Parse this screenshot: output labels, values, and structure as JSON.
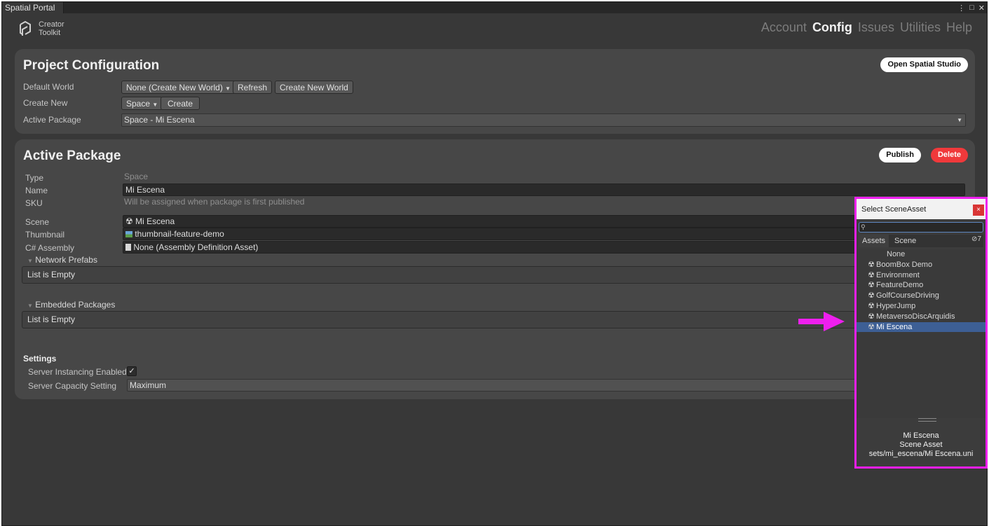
{
  "window": {
    "tab_title": "Spatial Portal",
    "controls": [
      "⋮",
      "□",
      "✕"
    ]
  },
  "logo": {
    "line1": "Creator",
    "line2": "Toolkit",
    "icon": "spatial-logo-icon"
  },
  "nav": {
    "items": [
      "Account",
      "Config",
      "Issues",
      "Utilities",
      "Help"
    ],
    "active": "Config"
  },
  "project_config": {
    "title": "Project Configuration",
    "open_studio_button": "Open Spatial Studio",
    "default_world_label": "Default World",
    "default_world_value": "None (Create New World)",
    "refresh_button": "Refresh",
    "create_world_button": "Create New World",
    "create_new_label": "Create New",
    "create_new_value": "Space",
    "create_button": "Create",
    "active_package_label": "Active Package",
    "active_package_value": "Space - Mi Escena"
  },
  "active_package": {
    "title": "Active Package",
    "publish_button": "Publish",
    "delete_button": "Delete",
    "type_label": "Type",
    "type_value": "Space",
    "name_label": "Name",
    "name_value": "Mi Escena",
    "sku_label": "SKU",
    "sku_value": "Will be assigned when package is first published",
    "scene_label": "Scene",
    "scene_value": "Mi Escena",
    "thumbnail_label": "Thumbnail",
    "thumbnail_value": "thumbnail-feature-demo",
    "assembly_label": "C# Assembly",
    "assembly_value": "None (Assembly Definition Asset)",
    "network_prefabs_label": "Network Prefabs",
    "network_prefabs_list": "List is Empty",
    "embedded_packages_label": "Embedded Packages",
    "embedded_packages_list": "List is Empty",
    "settings_heading": "Settings",
    "server_instancing_label": "Server Instancing Enabled",
    "server_instancing_checked": true,
    "server_capacity_label": "Server Capacity Setting",
    "server_capacity_value": "Maximum"
  },
  "picker": {
    "title": "Select SceneAsset",
    "close_glyph": "×",
    "search_value": "",
    "tabs": [
      "Assets",
      "Scene"
    ],
    "active_tab": "Assets",
    "hidden_count": "7",
    "items": [
      "None",
      "BoomBox Demo",
      "Environment",
      "FeatureDemo",
      "GolfCourseDriving",
      "HyperJump",
      "MetaversoDiscArquidis",
      "Mi Escena"
    ],
    "selected": "Mi Escena",
    "footer": {
      "name": "Mi Escena",
      "type": "Scene Asset",
      "path": "sets/mi_escena/Mi Escena.uni"
    }
  },
  "colors": {
    "highlight_border": "#ee1fee",
    "arrow": "#ee1fee",
    "delete_button": "#f0393b",
    "selection": "#3d5f95"
  }
}
